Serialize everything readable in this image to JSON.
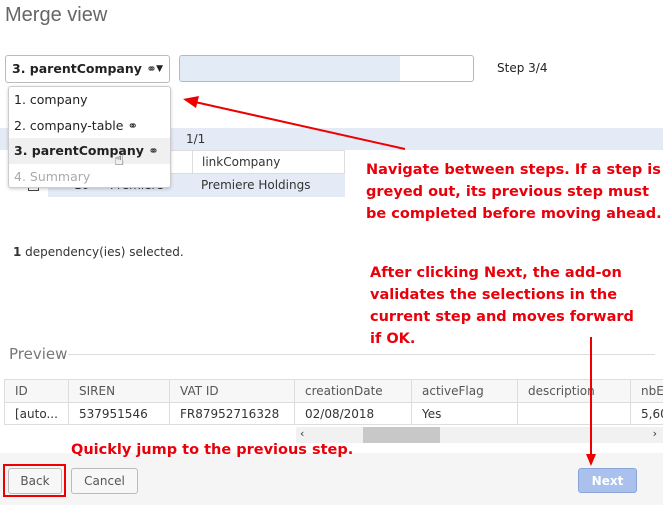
{
  "title": "Merge view",
  "step_select": {
    "value": "3. parentCompany",
    "options": [
      {
        "label": "1. company",
        "state": "normal",
        "linked": false
      },
      {
        "label": "2. company-table",
        "state": "normal",
        "linked": true
      },
      {
        "label": "3. parentCompany",
        "state": "selected",
        "linked": true
      },
      {
        "label": "4. Summary",
        "state": "disabled",
        "linked": false
      }
    ]
  },
  "progress": {
    "percent": 75
  },
  "step_label": "Step 3/4",
  "grid": {
    "pager": "1/1",
    "header": "linkCompany",
    "row": {
      "id": "10",
      "name": "Premiere",
      "link": "Premiere Holdings"
    }
  },
  "deps": {
    "count": "1",
    "text": " dependency(ies) selected."
  },
  "preview": {
    "label": "Preview",
    "columns": [
      "ID",
      "SIREN",
      "VAT ID",
      "creationDate",
      "activeFlag",
      "description",
      "nbE"
    ],
    "row": [
      "[auto...",
      "537951546",
      "FR87952716328",
      "02/08/2018",
      "Yes",
      "",
      "5,60"
    ]
  },
  "buttons": {
    "back": "Back",
    "cancel": "Cancel",
    "next": "Next"
  },
  "annotations": {
    "steps": "Navigate between steps. If a step is greyed out, its previous step must be completed before moving ahead.",
    "next": "After clicking Next, the add-on validates the selections in the current step and moves forward if OK.",
    "back": "Quickly jump to the previous step."
  },
  "colors": {
    "annotation": "#e8000b",
    "primary": "#a9c1ec"
  }
}
